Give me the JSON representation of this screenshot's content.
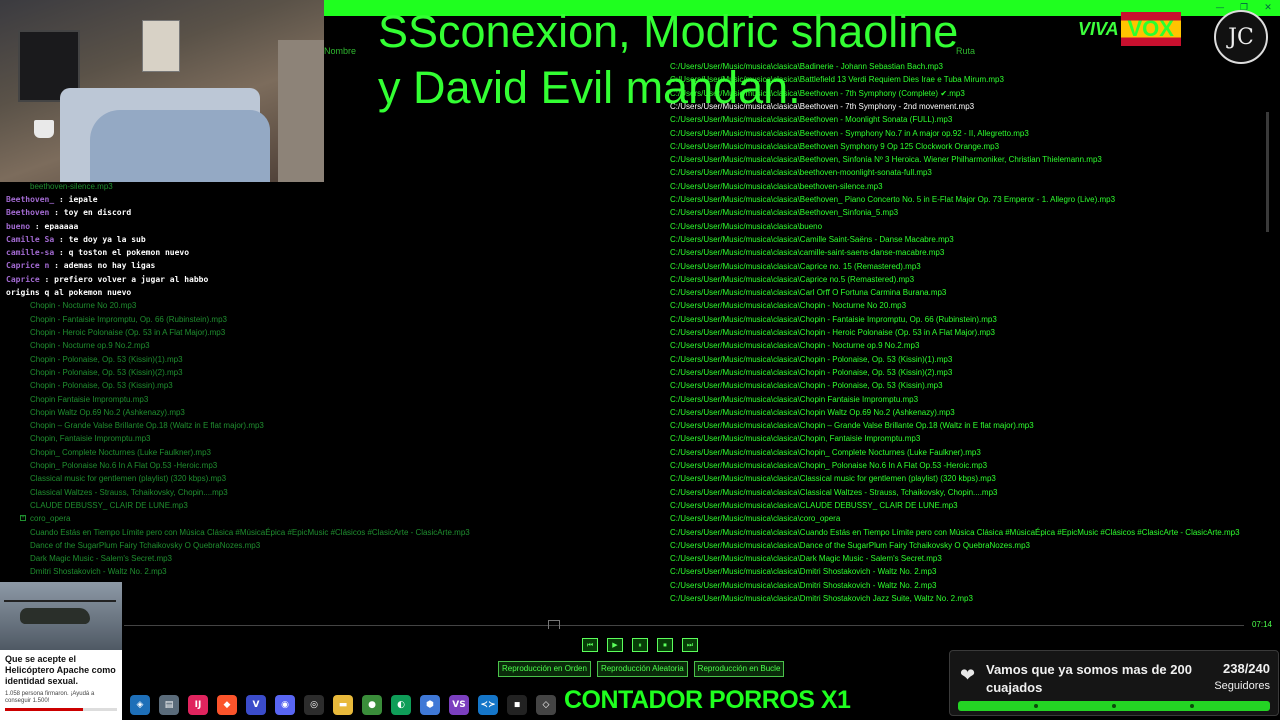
{
  "window": {
    "controls": [
      "—",
      "❐",
      "✕"
    ]
  },
  "stream": {
    "title_line1": "SSconexion, Modric shaoline",
    "title_line2": "y David Evil mandan.",
    "logo_viva": "VIVA",
    "logo_vox": "VOX",
    "channel_logo": "JC"
  },
  "columns": {
    "name": "Nombre",
    "path": "Ruta"
  },
  "files": [
    {
      "name": "",
      "path": "C:/Users/User/Music/musica\\clasica\\Badinerie - Johann Sebastian Bach.mp3"
    },
    {
      "name": "",
      "path": "C:/Users/User/Music/musica\\clasica\\Battlefield 13  Verdi Requiem  Dies Irae e Tuba Mirum.mp3"
    },
    {
      "name": "",
      "path": "C:/Users/User/Music/musica\\clasica\\Beethoven - 7th Symphony (Complete) ✔.mp3"
    },
    {
      "name": "",
      "path": "C:/Users/User/Music/musica\\clasica\\Beethoven - 7th Symphony - 2nd movement.mp3",
      "active": true
    },
    {
      "name": "",
      "path": "C:/Users/User/Music/musica\\clasica\\Beethoven - Moonlight Sonata (FULL).mp3"
    },
    {
      "name": "",
      "path": "C:/Users/User/Music/musica\\clasica\\Beethoven - Symphony No.7 in A major op.92 - II, Allegretto.mp3"
    },
    {
      "name": "",
      "path": "C:/Users/User/Music/musica\\clasica\\Beethoven Symphony 9 Op 125 Clockwork Orange.mp3"
    },
    {
      "name": "",
      "path": "C:/Users/User/Music/musica\\clasica\\Beethoven, Sinfonía Nº 3 Heroica. Wiener Philharmoniker, Christian Thielemann.mp3"
    },
    {
      "name": "",
      "path": "C:/Users/User/Music/musica\\clasica\\beethoven-moonlight-sonata-full.mp3"
    },
    {
      "name": "beethoven-silence.mp3",
      "path": "C:/Users/User/Music/musica\\clasica\\beethoven-silence.mp3"
    },
    {
      "name": "",
      "path": "C:/Users/User/Music/musica\\clasica\\Beethoven_ Piano Concerto No. 5 in E-Flat Major Op. 73 Emperor - 1. Allegro (Live).mp3"
    },
    {
      "name": "",
      "path": "C:/Users/User/Music/musica\\clasica\\Beethoven_Sinfonia_5.mp3"
    },
    {
      "name": "",
      "path": "C:/Users/User/Music/musica\\clasica\\bueno"
    },
    {
      "name": "",
      "path": "C:/Users/User/Music/musica\\clasica\\Camille Saint-Saëns - Danse Macabre.mp3"
    },
    {
      "name": "",
      "path": "C:/Users/User/Music/musica\\clasica\\camille-saint-saens-danse-macabre.mp3"
    },
    {
      "name": "",
      "path": "C:/Users/User/Music/musica\\clasica\\Caprice no. 15 (Remastered).mp3"
    },
    {
      "name": "",
      "path": "C:/Users/User/Music/musica\\clasica\\Caprice no.5 (Remastered).mp3"
    },
    {
      "name": "",
      "path": "C:/Users/User/Music/musica\\clasica\\Carl Orff  O Fortuna  Carmina Burana.mp3"
    },
    {
      "name": "Chopin  -  Nocturne No   20.mp3",
      "path": "C:/Users/User/Music/musica\\clasica\\Chopin  -  Nocturne No   20.mp3"
    },
    {
      "name": "Chopin - Fantaisie Impromptu, Op. 66 (Rubinstein).mp3",
      "path": "C:/Users/User/Music/musica\\clasica\\Chopin - Fantaisie Impromptu, Op. 66 (Rubinstein).mp3"
    },
    {
      "name": "Chopin - Heroic Polonaise (Op. 53 in A Flat Major).mp3",
      "path": "C:/Users/User/Music/musica\\clasica\\Chopin - Heroic Polonaise (Op. 53 in A Flat Major).mp3"
    },
    {
      "name": "Chopin - Nocturne op.9 No.2.mp3",
      "path": "C:/Users/User/Music/musica\\clasica\\Chopin - Nocturne op.9 No.2.mp3"
    },
    {
      "name": "Chopin - Polonaise, Op. 53 (Kissin)(1).mp3",
      "path": "C:/Users/User/Music/musica\\clasica\\Chopin - Polonaise, Op. 53 (Kissin)(1).mp3"
    },
    {
      "name": "Chopin - Polonaise, Op. 53 (Kissin)(2).mp3",
      "path": "C:/Users/User/Music/musica\\clasica\\Chopin - Polonaise, Op. 53 (Kissin)(2).mp3"
    },
    {
      "name": "Chopin - Polonaise, Op. 53 (Kissin).mp3",
      "path": "C:/Users/User/Music/musica\\clasica\\Chopin - Polonaise, Op. 53 (Kissin).mp3"
    },
    {
      "name": "Chopin Fantaisie Impromptu.mp3",
      "path": "C:/Users/User/Music/musica\\clasica\\Chopin Fantaisie Impromptu.mp3"
    },
    {
      "name": "Chopin Waltz Op.69 No.2 (Ashkenazy).mp3",
      "path": "C:/Users/User/Music/musica\\clasica\\Chopin Waltz Op.69 No.2 (Ashkenazy).mp3"
    },
    {
      "name": "Chopin – Grande Valse Brillante Op.18 (Waltz in E flat major).mp3",
      "path": "C:/Users/User/Music/musica\\clasica\\Chopin – Grande Valse Brillante Op.18 (Waltz in E flat major).mp3"
    },
    {
      "name": "Chopin, Fantaisie Impromptu.mp3",
      "path": "C:/Users/User/Music/musica\\clasica\\Chopin, Fantaisie Impromptu.mp3"
    },
    {
      "name": "Chopin_ Complete Nocturnes (Luke Faulkner).mp3",
      "path": "C:/Users/User/Music/musica\\clasica\\Chopin_ Complete Nocturnes (Luke Faulkner).mp3"
    },
    {
      "name": "Chopin_ Polonaise No.6 In A Flat Op.53 -Heroic.mp3",
      "path": "C:/Users/User/Music/musica\\clasica\\Chopin_ Polonaise No.6 In A Flat Op.53 -Heroic.mp3"
    },
    {
      "name": "Classical music for gentlemen (playlist) (320 kbps).mp3",
      "path": "C:/Users/User/Music/musica\\clasica\\Classical music for gentlemen (playlist) (320 kbps).mp3"
    },
    {
      "name": "Classical Waltzes - Strauss, Tchaikovsky, Chopin....mp3",
      "path": "C:/Users/User/Music/musica\\clasica\\Classical Waltzes - Strauss, Tchaikovsky, Chopin....mp3"
    },
    {
      "name": "CLAUDE DEBUSSY_  CLAIR DE LUNE.mp3",
      "path": "C:/Users/User/Music/musica\\clasica\\CLAUDE DEBUSSY_  CLAIR DE LUNE.mp3"
    },
    {
      "name": "coro_opera",
      "path": "C:/Users/User/Music/musica\\clasica\\coro_opera",
      "folder": true
    },
    {
      "name": "Cuando Estás en Tiempo Límite pero con Música Clásica #MúsicaÉpica #EpicMusic #Clásicos #ClasicArte - ClasicArte.mp3",
      "path": "C:/Users/User/Music/musica\\clasica\\Cuando Estás en Tiempo Límite pero con Música Clásica #MúsicaÉpica #EpicMusic #Clásicos #ClasicArte - ClasicArte.mp3"
    },
    {
      "name": "Dance of the SugarPlum Fairy  Tchaikovsky  O QuebraNozes.mp3",
      "path": "C:/Users/User/Music/musica\\clasica\\Dance of the SugarPlum Fairy  Tchaikovsky  O QuebraNozes.mp3"
    },
    {
      "name": "Dark Magic Music -  Salem's Secret.mp3",
      "path": "C:/Users/User/Music/musica\\clasica\\Dark Magic Music -  Salem's Secret.mp3"
    },
    {
      "name": "Dmitri Shostakovich -  Waltz No. 2.mp3",
      "path": "C:/Users/User/Music/musica\\clasica\\Dmitri Shostakovich -  Waltz No. 2.mp3"
    },
    {
      "name": "tz No. 2.mp3",
      "path": "C:/Users/User/Music/musica\\clasica\\Dmitri Shostakovich - Waltz No. 2.mp3"
    },
    {
      "name": "uite, Waltz No. 2.mp3",
      "path": "C:/Users/User/Music/musica\\clasica\\Dmitri Shostakovich Jazz Suite, Waltz No. 2.mp3"
    }
  ],
  "chat": [
    {
      "user": "Beethoven_",
      "text": " : iepale"
    },
    {
      "user": "Beethoven",
      "text": " : toy en discord"
    },
    {
      "user": "bueno",
      "text": " : epaaaaa"
    },
    {
      "user": "Camille Sa",
      "text": " : te doy ya la sub"
    },
    {
      "user": "camille-sa",
      "text": " : q toston el pokemon nuevo"
    },
    {
      "user": "Caprice n",
      "text": " : ademas no hay ligas"
    },
    {
      "user": "Caprice",
      "text": " : prefiero volver a jugar al habbo"
    },
    {
      "user": "",
      "text": "origins q al pokemon nuevo"
    }
  ],
  "player": {
    "time": "07:14",
    "controls": [
      "⏮",
      "▶",
      "⏸",
      "⏹",
      "⏭"
    ],
    "modes": [
      "Reproducción en Orden",
      "Reproducción Aleatoria",
      "Reproducción en Bucle"
    ]
  },
  "notification": {
    "headline": "Que se acepte el Helicóptero Apache como identidad sexual.",
    "sub": "1.058 persona firmaron. ¡Ayudá a conseguir 1.500!"
  },
  "taskbar": {
    "icons": [
      {
        "name": "app-icon",
        "glyph": "◈",
        "color": "#1e6fb8"
      },
      {
        "name": "notepad-icon",
        "glyph": "▤",
        "color": "#5a6b7a"
      },
      {
        "name": "intellij-icon",
        "glyph": "IJ",
        "color": "#e0245e"
      },
      {
        "name": "brave-icon",
        "glyph": "◆",
        "color": "#fb542b"
      },
      {
        "name": "v-icon",
        "glyph": "V",
        "color": "#3b4cca"
      },
      {
        "name": "discord-icon",
        "glyph": "◉",
        "color": "#5865f2"
      },
      {
        "name": "obs-icon",
        "glyph": "◎",
        "color": "#2c2c2c"
      },
      {
        "name": "folder-icon",
        "glyph": "▬",
        "color": "#e8b93b"
      },
      {
        "name": "chrome-icon",
        "glyph": "●",
        "color": "#3a8d3a"
      },
      {
        "name": "green-app-icon",
        "glyph": "◐",
        "color": "#0f9d58"
      },
      {
        "name": "cube-icon",
        "glyph": "⬢",
        "color": "#3f78d6"
      },
      {
        "name": "vs-icon",
        "glyph": "VS",
        "color": "#7b3fbf"
      },
      {
        "name": "vscode-icon",
        "glyph": "≺≻",
        "color": "#1576c9"
      },
      {
        "name": "epic-icon",
        "glyph": "◾",
        "color": "#222"
      },
      {
        "name": "unity-icon",
        "glyph": "◇",
        "color": "#444"
      }
    ]
  },
  "counter": "CONTADOR PORROS X1",
  "followers": {
    "message": "Vamos que ya somos mas de 200 cuajados",
    "count": "238/240",
    "label": "Seguidores",
    "progress": 0.99
  }
}
